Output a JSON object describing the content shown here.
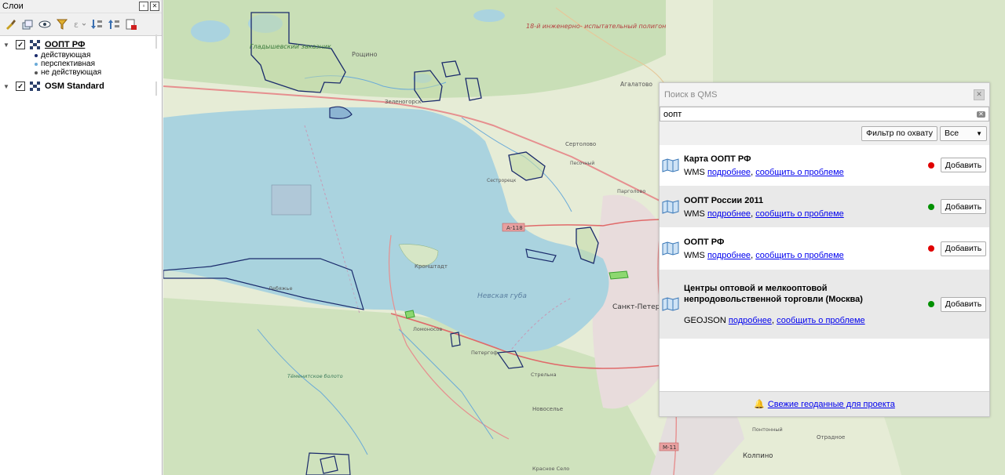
{
  "layers_panel": {
    "title": "Слои",
    "layers": [
      {
        "name": "ООПТ РФ",
        "checked": true,
        "legend": [
          {
            "label": "действующая",
            "color": "#1a2a6b"
          },
          {
            "label": "перспективная",
            "color": "#6aaad8"
          },
          {
            "label": "не действующая",
            "color": "#555555"
          }
        ]
      },
      {
        "name": "OSM Standard",
        "checked": true
      }
    ]
  },
  "map": {
    "labels": {
      "zakaznik": "Гладышевский заказник",
      "poligon": "18-й инженерно- испытательный полигон",
      "roshchino": "Рощино",
      "zelenogorsk": "Зеленогорск",
      "agalatovo": "Агалатово",
      "sertolovo": "Сертолово",
      "pesochny": "Песочный",
      "sestroretsk": "Сестрорецк",
      "pargolovo": "Парголово",
      "kronshtadt": "Кронштадт",
      "neva_bay": "Невская губа",
      "spb": "Санкт-Петер",
      "peterhof": "Петергоф",
      "lomonosov": "Ломоносов",
      "strelna": "Стрельна",
      "lebyazhye": "Лебяжье",
      "novoselye": "Новоселье",
      "kolpino": "Колпино",
      "krasnoe_selo": "Красное Село",
      "otradnoe": "Отрадное",
      "pontonny": "Понтонный",
      "temenitskoe": "Тёменитское болото",
      "a118": "А-118",
      "m11": "М-11"
    }
  },
  "qms": {
    "title": "Поиск в QMS",
    "search_value": "оопт",
    "filter_button": "Фильтр по охвату",
    "filter_select": "Все",
    "results": [
      {
        "title": "Карта ООПТ РФ",
        "type": "WMS",
        "details": "подробнее",
        "report": "сообщить о проблеме",
        "status_color": "#e00000",
        "add": "Добавить"
      },
      {
        "title": "ООПТ России 2011",
        "type": "WMS",
        "details": "подробнее",
        "report": "сообщить о проблеме",
        "status_color": "#009000",
        "add": "Добавить"
      },
      {
        "title": "ООПТ РФ",
        "type": "WMS",
        "details": "подробнее",
        "report": "сообщить о проблеме",
        "status_color": "#e00000",
        "add": "Добавить"
      },
      {
        "title": "Центры оптовой и мелкооптовой непродовольственной торговли (Москва)",
        "type": "GEOJSON",
        "details": "подробнее",
        "report": "сообщить о проблеме",
        "status_color": "#009000",
        "add": "Добавить"
      }
    ],
    "footer_link": "Свежие геоданные для проекта"
  }
}
